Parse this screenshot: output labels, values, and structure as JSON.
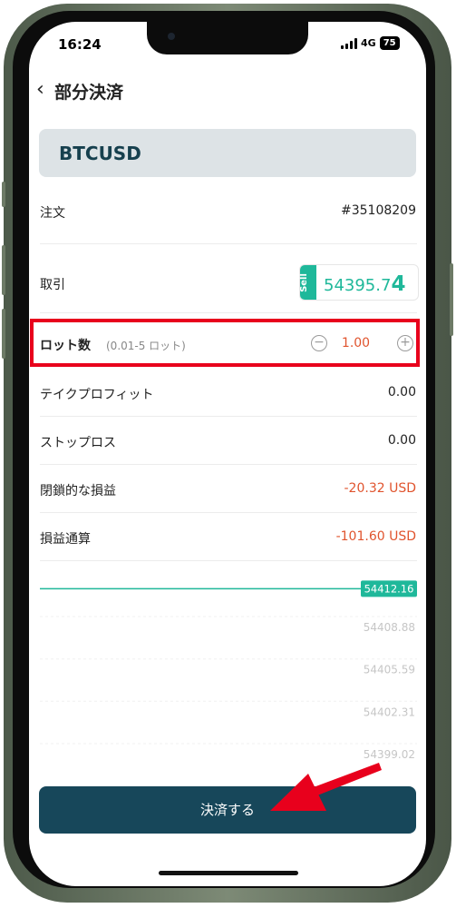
{
  "status_bar": {
    "time": "16:24",
    "network": "4G",
    "battery": "75"
  },
  "header": {
    "back_icon": "chevron-left-icon",
    "title": "部分決済"
  },
  "symbol": "BTCUSD",
  "order": {
    "label": "注文",
    "value": "#35108209"
  },
  "trade": {
    "label": "取引",
    "side": "Sell",
    "price_main": "54395.7",
    "price_tail": "4"
  },
  "lot": {
    "label": "ロット数",
    "range": "(0.01-5 ロット)",
    "value": "1.00",
    "minus_icon": "minus-circle-icon",
    "plus_icon": "plus-circle-icon"
  },
  "take_profit": {
    "label": "テイクプロフィット",
    "value": "0.00"
  },
  "stop_loss": {
    "label": "ストップロス",
    "value": "0.00"
  },
  "closed_pnl": {
    "label": "閉鎖的な損益",
    "value": "-20.32 USD"
  },
  "pnl_total": {
    "label": "損益通算",
    "value": "-101.60 USD"
  },
  "chart_data": {
    "type": "line",
    "series": [
      {
        "values": [
          54412.16,
          54412.16
        ]
      }
    ],
    "current_price_label": "54412.16",
    "y_ticks": [
      "54408.88",
      "54405.59",
      "54402.31",
      "54399.02"
    ]
  },
  "close_button": {
    "label": "決済する"
  },
  "colors": {
    "accent": "#1fb89a",
    "negative": "#e0542e",
    "button": "#17475a",
    "highlight": "#e8001c"
  }
}
